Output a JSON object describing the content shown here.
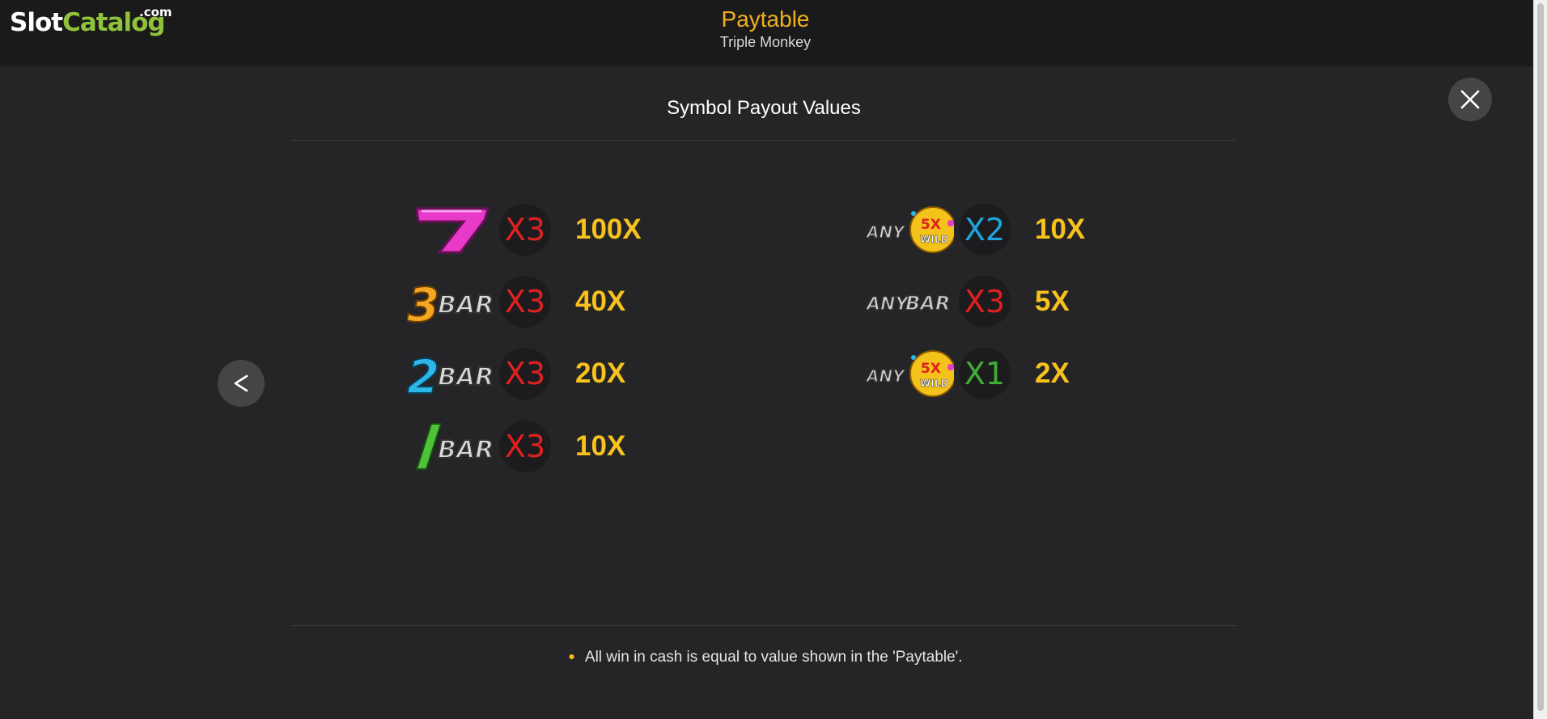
{
  "logo": {
    "slot": "Slot",
    "catalog": "Catalog",
    "com": ".com"
  },
  "header": {
    "title": "Paytable",
    "subtitle": "Triple Monkey"
  },
  "section_title": "Symbol Payout Values",
  "left_column": [
    {
      "symbol": "seven-icon",
      "multiplier": "X3",
      "mult_color": "#e0201e",
      "payout": "100X"
    },
    {
      "symbol": "3bar-icon",
      "multiplier": "X3",
      "mult_color": "#e0201e",
      "payout": "40X"
    },
    {
      "symbol": "2bar-icon",
      "multiplier": "X3",
      "mult_color": "#e0201e",
      "payout": "20X"
    },
    {
      "symbol": "1bar-icon",
      "multiplier": "X3",
      "mult_color": "#e0201e",
      "payout": "10X"
    }
  ],
  "right_column": [
    {
      "symbol": "any-5x-wild-icon",
      "multiplier": "X2",
      "mult_color": "#1da6df",
      "payout": "10X"
    },
    {
      "symbol": "any-bar-icon",
      "multiplier": "X3",
      "mult_color": "#e0201e",
      "payout": "5X"
    },
    {
      "symbol": "any-5x-wild-icon",
      "multiplier": "X1",
      "mult_color": "#3fae35",
      "payout": "2X"
    }
  ],
  "symbol_texts": {
    "bar": "BAR",
    "any": "ANY",
    "wild_5x": "5X",
    "wild": "WILD"
  },
  "footnote": "All win in cash is equal to value shown in the 'Paytable'.",
  "colors": {
    "accent": "#f2b01e",
    "payout": "#f7c21e",
    "background": "#252426",
    "topbar": "#1a1a1a"
  }
}
